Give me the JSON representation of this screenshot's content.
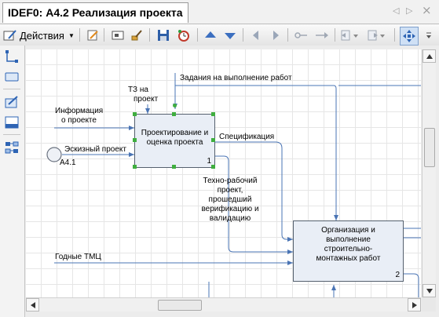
{
  "window": {
    "tab_title": "IDEF0: А4.2 Реализация проекта",
    "nav_left": "◁",
    "nav_right": "▷",
    "close": "×"
  },
  "toolbar": {
    "actions_label": "Действия",
    "actions_arrow": "▼"
  },
  "diagram": {
    "inputs": [
      {
        "label_lines": [
          "Информация",
          "о проекте"
        ]
      },
      {
        "label": "Эскизный проект"
      },
      {
        "label": "Годные ТМЦ"
      }
    ],
    "controls": [
      {
        "label_lines": [
          "ТЗ на",
          "проект"
        ]
      },
      {
        "label": "Задания на выполнение работ"
      }
    ],
    "outputs": [
      {
        "label": "Спецификация"
      },
      {
        "label_lines": [
          "Техно-рабочий",
          "проект,",
          "прошедший",
          "верификацию и",
          "валидацию"
        ]
      }
    ],
    "reference": {
      "label": "А4.1"
    },
    "activities": [
      {
        "title_lines": [
          "Проектирование и",
          "оценка проекта"
        ],
        "number": "1"
      },
      {
        "title_lines": [
          "Организация и",
          "выполнение",
          "строительно-",
          "монтажных работ"
        ],
        "number": "2"
      }
    ]
  },
  "colors": {
    "arrow": "#4a74b4",
    "box_fill": "#e9eef6",
    "selection_handle": "#3fae3f"
  }
}
